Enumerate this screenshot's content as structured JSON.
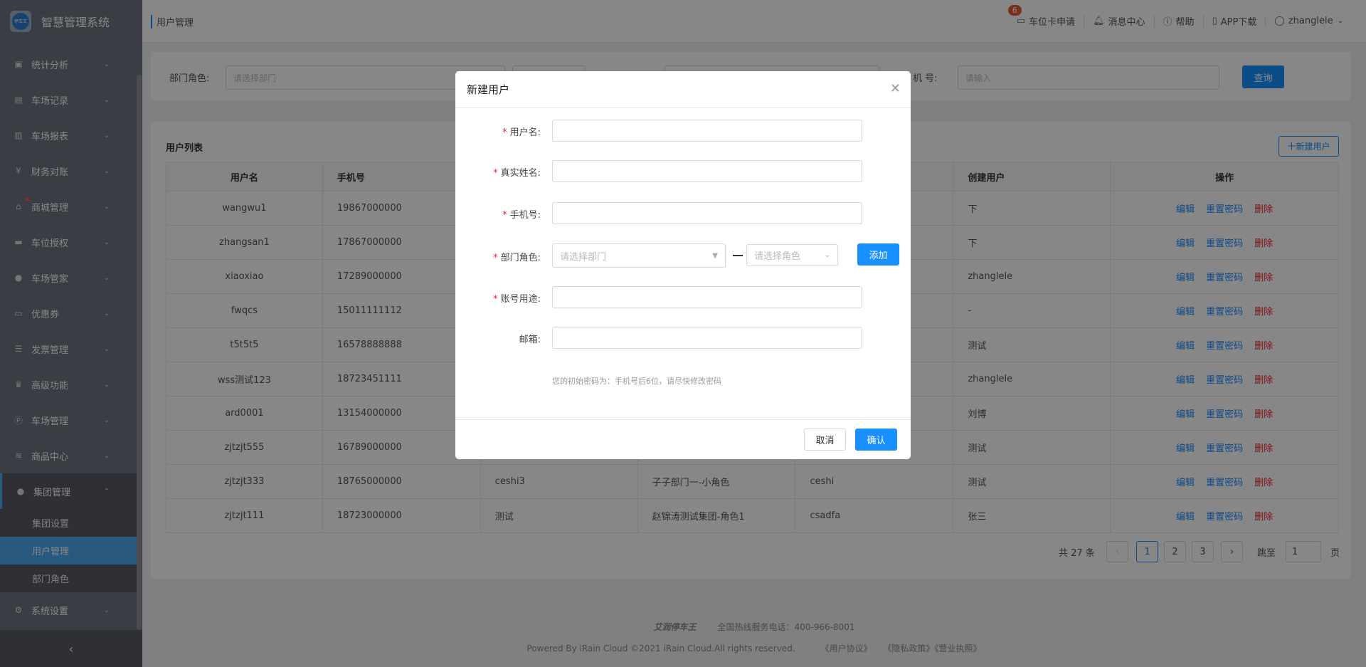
{
  "app": {
    "title": "智慧管理系统",
    "logo_text": "停车王"
  },
  "sidebar": {
    "items": [
      {
        "label": "统计分析",
        "icon": "monitor-icon"
      },
      {
        "label": "车场记录",
        "icon": "document-icon"
      },
      {
        "label": "车场报表",
        "icon": "report-icon"
      },
      {
        "label": "财务对账",
        "icon": "yen-icon"
      },
      {
        "label": "商城管理",
        "icon": "shop-icon"
      },
      {
        "label": "车位授权",
        "icon": "car-icon"
      },
      {
        "label": "车场管家",
        "icon": "user-icon"
      },
      {
        "label": "优惠券",
        "icon": "ticket-icon"
      },
      {
        "label": "发票管理",
        "icon": "invoice-icon"
      },
      {
        "label": "高级功能",
        "icon": "crown-icon"
      },
      {
        "label": "车场管理",
        "icon": "parking-icon"
      },
      {
        "label": "商品中心",
        "icon": "layers-icon"
      }
    ],
    "group": {
      "label": "集团管理",
      "sub": [
        "集团设置",
        "用户管理",
        "部门角色"
      ]
    },
    "system": {
      "label": "系统设置"
    }
  },
  "header": {
    "breadcrumb": "用户管理",
    "card_apply": "车位卡申请",
    "badge": "6",
    "messages": "消息中心",
    "help": "帮助",
    "app_download": "APP下载",
    "user": "zhanglele"
  },
  "filter": {
    "dept_label": "部门角色:",
    "dept_placeholder": "请选择部门",
    "phone_label": "机 号:",
    "phone_placeholder": "请输入",
    "query": "查询"
  },
  "list": {
    "title": "用户列表",
    "new_button": "十新建用户",
    "columns": [
      "用户名",
      "手机号",
      "",
      "",
      "",
      "创建用户",
      "操作"
    ],
    "actions": {
      "edit": "编辑",
      "reset": "重置密码",
      "delete": "删除"
    },
    "rows": [
      [
        "wangwu1",
        "19867000000",
        "",
        "",
        "",
        "下"
      ],
      [
        "zhangsan1",
        "17867000000",
        "",
        "",
        "",
        "下"
      ],
      [
        "xiaoxiao",
        "17289000000",
        "",
        "",
        "",
        "zhanglele"
      ],
      [
        "fwqcs",
        "15011111112",
        "",
        "",
        "",
        "-"
      ],
      [
        "t5t5t5",
        "16578888888",
        "",
        "",
        "",
        "测试"
      ],
      [
        "wss测试123",
        "18723451111",
        "",
        "",
        "",
        "zhanglele"
      ],
      [
        "ard0001",
        "13154000000",
        "",
        "",
        "",
        "刘博"
      ],
      [
        "zjtzjt555",
        "16789000000",
        "",
        "",
        "",
        "测试"
      ],
      [
        "zjtzjt333",
        "18765000000",
        "ceshi3",
        "子子部门一-小角色",
        "ceshi",
        "测试"
      ],
      [
        "zjtzjt111",
        "18723000000",
        "测试",
        "赵锦涛测试集团-角色1",
        "csadfa",
        "张三"
      ]
    ]
  },
  "pagination": {
    "total": "共 27 条",
    "pages": [
      "1",
      "2",
      "3"
    ],
    "jump": "跳至",
    "jump_value": "1",
    "page_unit": "页"
  },
  "footer": {
    "brand": "艾润停车王",
    "hotline": "全国热线服务电话：400-966-8001",
    "copyright": "Powered By iRain Cloud ©2021 iRain Cloud.All rights reserved.",
    "links": [
      "《用户协议》",
      "《隐私政策》",
      "《营业执照》"
    ]
  },
  "modal": {
    "title": "新建用户",
    "fields": {
      "username": "用户名:",
      "realname": "真实姓名:",
      "phone": "手机号:",
      "dept_role": "部门角色:",
      "purpose": "账号用途:",
      "email": "邮箱:"
    },
    "dept_placeholder": "请选择部门",
    "role_placeholder": "请选择角色",
    "add": "添加",
    "hint": "您的初始密码为：手机号后6位，请尽快修改密码",
    "cancel": "取消",
    "confirm": "确认"
  },
  "colors": {
    "primary": "#1890ff",
    "danger": "#f5222d"
  }
}
